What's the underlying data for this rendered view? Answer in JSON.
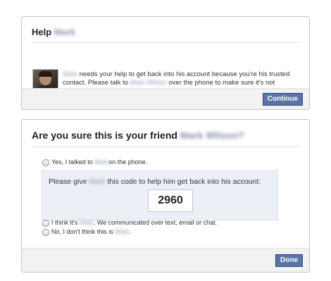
{
  "help_card": {
    "title_prefix": "Help",
    "title_name": "Mark",
    "message_name": "Mark",
    "message_part1": " needs your help to get back into his account because you're his trusted contact. Please talk to ",
    "message_contact_name": "Mark Wilson",
    "message_part2": " over the phone to make sure it's not someone pretending to be him.",
    "continue_label": "Continue"
  },
  "verify_card": {
    "title_prefix": "Are you sure this is your friend ",
    "title_name": "Mark Wilson?",
    "option_phone_prefix": "Yes, I talked to ",
    "option_phone_name": "Mark",
    "option_phone_suffix": " on the phone.",
    "code_prefix": "Please give ",
    "code_name": "Mark",
    "code_suffix": " this code to help him get back into his account:",
    "code": "2960",
    "option_text_prefix": "I think it's ",
    "option_text_name": "Mark",
    "option_text_suffix": ". We communicated over text, email or chat.",
    "option_no_prefix": "No, I don't think this is ",
    "option_no_name": "Mark",
    "option_no_suffix": ".",
    "done_label": "Done"
  },
  "colors": {
    "button_bg": "#5b74a8",
    "panel_bg": "#eceff5",
    "footer_bg": "#f2f2f2"
  }
}
